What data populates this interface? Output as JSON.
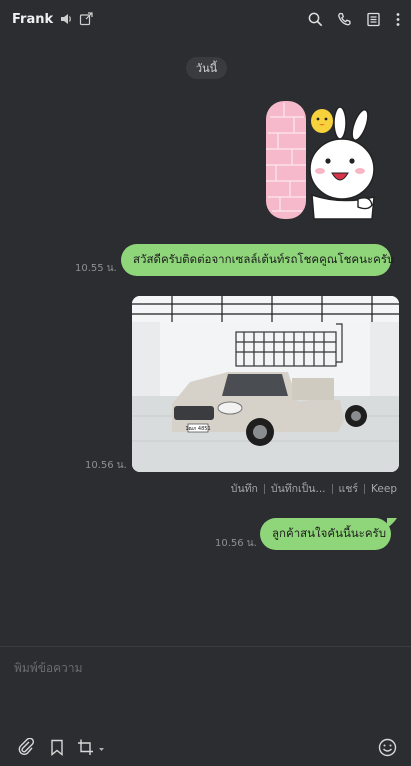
{
  "header": {
    "title": "Frank",
    "icons": [
      "speaker-icon",
      "external-link-icon",
      "search-icon",
      "phone-icon",
      "notes-icon",
      "more-icon"
    ]
  },
  "date_label": "วันนี้",
  "messages": [
    {
      "type": "sticker",
      "icon": "cony-sticker"
    },
    {
      "type": "text",
      "text": "สวัสดีครับติดต่อจากเซลล์เต้นท์รถโชคคูณโชคนะครับ",
      "time": "10.55 น."
    },
    {
      "type": "image",
      "time": "10.56 น.",
      "plate": "1ฒภ 4851"
    },
    {
      "type": "text",
      "text": "ลูกค้าสนใจคันนี้นะครับ",
      "time": "10.56 น."
    }
  ],
  "image_actions": [
    "บันทึก",
    "บันทึกเป็น...",
    "แชร์",
    "Keep"
  ],
  "composer": {
    "placeholder": "พิมพ์ข้อความ"
  },
  "toolbar": {
    "icons": [
      "attach-icon",
      "bookmark-icon",
      "crop-icon",
      "emoji-icon"
    ]
  },
  "colors": {
    "background": "#2c2d30",
    "bubble": "#8fd67a"
  }
}
